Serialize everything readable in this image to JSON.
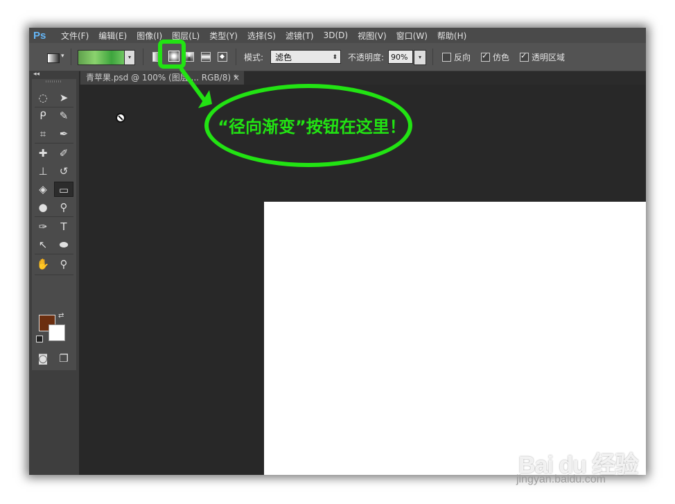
{
  "app": {
    "logo": "Ps",
    "menu": [
      "文件(F)",
      "编辑(E)",
      "图像(I)",
      "图层(L)",
      "类型(Y)",
      "选择(S)",
      "滤镜(T)",
      "3D(D)",
      "视图(V)",
      "窗口(W)",
      "帮助(H)"
    ]
  },
  "options_bar": {
    "mode_label": "模式:",
    "mode_value": "滤色",
    "opacity_label": "不透明度:",
    "opacity_value": "90%",
    "reverse_label": "反向",
    "reverse_checked": false,
    "dither_label": "仿色",
    "dither_checked": true,
    "transparency_label": "透明区域",
    "transparency_checked": true,
    "active_gradient_type": "radial"
  },
  "document": {
    "tab_title": "青苹果.psd @ 100% (图层 ... RGB/8) *",
    "close_glyph": "×"
  },
  "toolbox": {
    "foreground_color": "#6b2e0f",
    "background_color": "#ffffff",
    "active_tool": "gradient-tool"
  },
  "annotation": {
    "text": "“径向渐变”按钮在这里！",
    "color": "#22e313"
  },
  "watermark": {
    "logo": "Bai du 经验",
    "url": "jingyan.baidu.com"
  }
}
